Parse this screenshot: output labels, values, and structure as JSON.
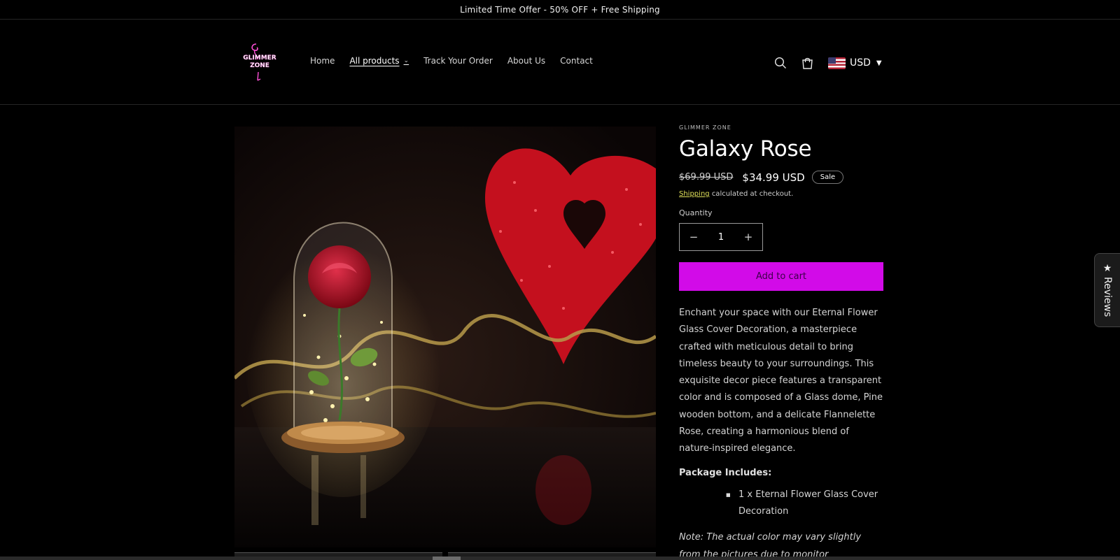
{
  "announcement": "Limited Time Offer - 50% OFF + Free Shipping",
  "brand": {
    "logo_text": "GLIMMER ZONE"
  },
  "nav": [
    {
      "label": "Home"
    },
    {
      "label": "All products"
    },
    {
      "label": "Track Your Order"
    },
    {
      "label": "About Us"
    },
    {
      "label": "Contact"
    }
  ],
  "header_icons": {
    "search": "search-icon",
    "cart": "cart-icon"
  },
  "currency": {
    "code": "USD",
    "flag": "us-flag-icon"
  },
  "product": {
    "vendor": "GLIMMER ZONE",
    "title": "Galaxy Rose",
    "compare_price": "$69.99 USD",
    "price": "$34.99 USD",
    "sale_badge": "Sale",
    "shipping_link": "Shipping",
    "shipping_text": "calculated at checkout.",
    "quantity_label": "Quantity",
    "quantity": "1",
    "minus": "−",
    "plus": "+",
    "add_to_cart": "Add to cart",
    "description": "Enchant your space with our Eternal Flower Glass Cover Decoration, a masterpiece crafted with meticulous detail to bring timeless beauty to your surroundings. This exquisite decor piece features a transparent color and is composed of a Glass dome, Pine wooden bottom, and a delicate Flannelette Rose, creating a harmonious blend of nature-inspired elegance.",
    "package_heading": "Package Includes:",
    "package_items": [
      "1 x Eternal Flower Glass Cover Decoration"
    ],
    "note": "Note: The actual color may vary slightly from the pictures due to monitor differences. Thank"
  },
  "reviews_tab": {
    "label": "Reviews",
    "icon": "star-icon"
  },
  "colors": {
    "accent": "#d20be8",
    "background": "#000000",
    "link": "#e0e05a"
  }
}
